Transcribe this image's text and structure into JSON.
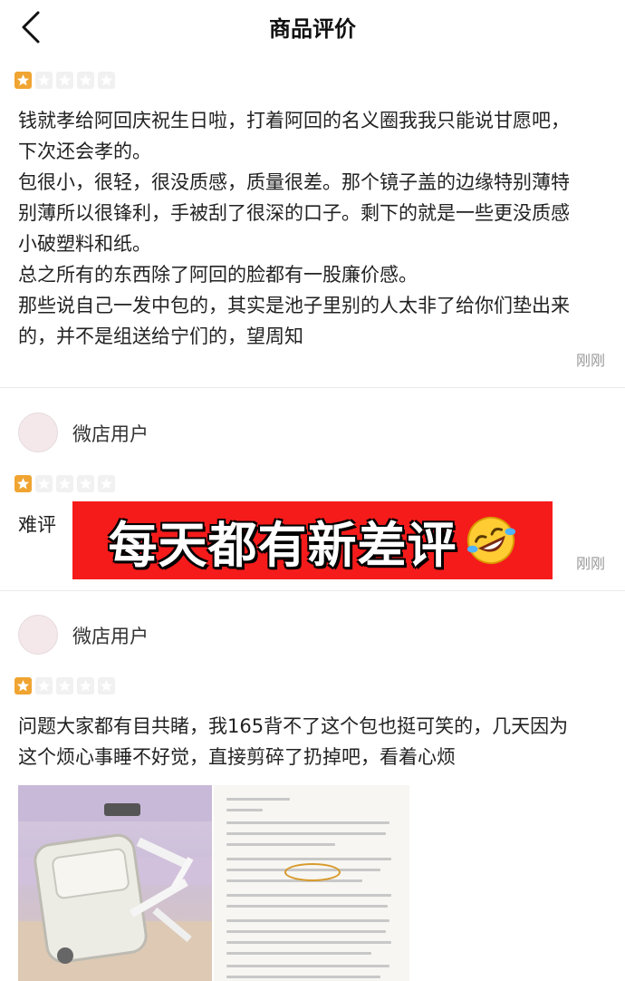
{
  "header": {
    "title": "商品评价"
  },
  "reviews": [
    {
      "rating": 1,
      "text": "钱就孝给阿回庆祝生日啦，打着阿回的名义圈我我只能说甘愿吧，\n下次还会孝的。\n包很小，很轻，很没质感，质量很差。那个镜子盖的边缘特别薄特\n别薄所以很锋利，手被刮了很深的口子。剩下的就是一些更没质感\n小破塑料和纸。\n总之所有的东西除了阿回的脸都有一股廉价感。\n那些说自己一发中包的，其实是池子里别的人太非了给你们垫出来\n的，并不是组送给宁们的，望周知",
      "time": "刚刚"
    },
    {
      "user": "微店用户",
      "rating": 1,
      "text": "难评",
      "time": "刚刚"
    },
    {
      "user": "微店用户",
      "rating": 1,
      "text": "问题大家都有目共睹，我165背不了这个包也挺可笑的，几天因为\n这个烦心事睡不好觉，直接剪碎了扔掉吧，看着心烦"
    }
  ],
  "overlay": {
    "caption": "每天都有新差评",
    "emoji": "rolling-laughing-emoji",
    "color": "#f51b1b"
  },
  "colors": {
    "star_on": "#f0a431",
    "star_off": "#f1f1f1",
    "muted": "#999999"
  }
}
